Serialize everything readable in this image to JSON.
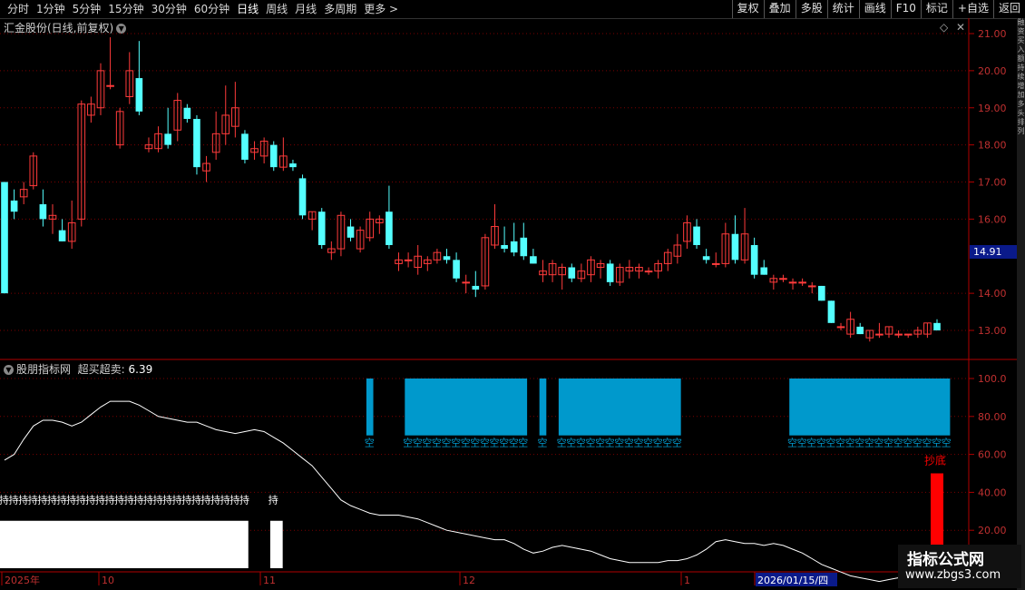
{
  "toolbar": {
    "periods": [
      "分时",
      "1分钟",
      "5分钟",
      "15分钟",
      "30分钟",
      "60分钟",
      "日线",
      "周线",
      "月线",
      "多周期",
      "更多 >"
    ],
    "active_period": "日线",
    "actions": [
      "复权",
      "叠加",
      "多股",
      "统计",
      "画线",
      "F10",
      "标记",
      "+自选",
      "返回"
    ]
  },
  "chart": {
    "title": "汇金股份(日线,前复权)",
    "current_price": "14.91",
    "y_ticks": [
      "21.00",
      "20.00",
      "19.00",
      "18.00",
      "17.00",
      "16.00",
      "14.00",
      "13.00"
    ],
    "candles": [
      {
        "o": 17.0,
        "h": 17.0,
        "l": 14.0,
        "c": 14.0
      },
      {
        "o": 16.5,
        "h": 16.8,
        "l": 16.0,
        "c": 16.2
      },
      {
        "o": 16.6,
        "h": 17.0,
        "l": 16.4,
        "c": 16.8
      },
      {
        "o": 16.9,
        "h": 17.8,
        "l": 16.8,
        "c": 17.7
      },
      {
        "o": 16.4,
        "h": 16.8,
        "l": 15.8,
        "c": 16.0
      },
      {
        "o": 16.0,
        "h": 16.4,
        "l": 15.6,
        "c": 16.1
      },
      {
        "o": 15.7,
        "h": 16.0,
        "l": 15.4,
        "c": 15.4
      },
      {
        "o": 15.4,
        "h": 16.5,
        "l": 15.2,
        "c": 15.9
      },
      {
        "o": 16.0,
        "h": 19.2,
        "l": 15.8,
        "c": 19.1
      },
      {
        "o": 18.8,
        "h": 19.3,
        "l": 18.6,
        "c": 19.1
      },
      {
        "o": 19.0,
        "h": 20.2,
        "l": 18.8,
        "c": 20.0
      },
      {
        "o": 19.6,
        "h": 20.9,
        "l": 19.5,
        "c": 19.6
      },
      {
        "o": 18.0,
        "h": 19.0,
        "l": 17.9,
        "c": 18.9
      },
      {
        "o": 19.3,
        "h": 20.5,
        "l": 19.1,
        "c": 20.0
      },
      {
        "o": 19.8,
        "h": 20.8,
        "l": 18.8,
        "c": 18.9
      },
      {
        "o": 17.9,
        "h": 18.2,
        "l": 17.8,
        "c": 18.0
      },
      {
        "o": 17.9,
        "h": 18.5,
        "l": 17.8,
        "c": 18.3
      },
      {
        "o": 18.3,
        "h": 19.0,
        "l": 17.9,
        "c": 18.0
      },
      {
        "o": 18.4,
        "h": 19.4,
        "l": 18.1,
        "c": 19.2
      },
      {
        "o": 19.0,
        "h": 19.1,
        "l": 18.6,
        "c": 18.7
      },
      {
        "o": 18.7,
        "h": 18.8,
        "l": 17.2,
        "c": 17.4
      },
      {
        "o": 17.3,
        "h": 17.7,
        "l": 17.0,
        "c": 17.5
      },
      {
        "o": 17.8,
        "h": 18.9,
        "l": 17.6,
        "c": 18.3
      },
      {
        "o": 18.3,
        "h": 19.6,
        "l": 18.0,
        "c": 18.8
      },
      {
        "o": 18.5,
        "h": 19.7,
        "l": 18.2,
        "c": 19.0
      },
      {
        "o": 18.3,
        "h": 18.4,
        "l": 17.5,
        "c": 17.6
      },
      {
        "o": 17.8,
        "h": 18.1,
        "l": 17.6,
        "c": 17.9
      },
      {
        "o": 17.7,
        "h": 18.2,
        "l": 17.5,
        "c": 18.1
      },
      {
        "o": 18.0,
        "h": 18.1,
        "l": 17.3,
        "c": 17.4
      },
      {
        "o": 17.4,
        "h": 18.2,
        "l": 17.3,
        "c": 17.7
      },
      {
        "o": 17.5,
        "h": 17.6,
        "l": 17.3,
        "c": 17.4
      },
      {
        "o": 17.1,
        "h": 17.2,
        "l": 16.0,
        "c": 16.1
      },
      {
        "o": 16.0,
        "h": 16.2,
        "l": 15.7,
        "c": 16.2
      },
      {
        "o": 16.2,
        "h": 16.3,
        "l": 15.2,
        "c": 15.3
      },
      {
        "o": 15.1,
        "h": 15.4,
        "l": 14.9,
        "c": 15.2
      },
      {
        "o": 15.2,
        "h": 16.2,
        "l": 15.0,
        "c": 16.1
      },
      {
        "o": 15.8,
        "h": 16.0,
        "l": 15.4,
        "c": 15.5
      },
      {
        "o": 15.2,
        "h": 15.8,
        "l": 15.1,
        "c": 15.7
      },
      {
        "o": 15.5,
        "h": 16.2,
        "l": 15.4,
        "c": 16.0
      },
      {
        "o": 15.9,
        "h": 16.1,
        "l": 15.6,
        "c": 16.0
      },
      {
        "o": 16.2,
        "h": 16.9,
        "l": 15.2,
        "c": 15.3
      },
      {
        "o": 14.8,
        "h": 15.1,
        "l": 14.6,
        "c": 14.9
      },
      {
        "o": 14.9,
        "h": 15.1,
        "l": 14.7,
        "c": 14.9
      },
      {
        "o": 14.7,
        "h": 15.3,
        "l": 14.5,
        "c": 15.0
      },
      {
        "o": 14.8,
        "h": 15.0,
        "l": 14.6,
        "c": 14.9
      },
      {
        "o": 14.9,
        "h": 15.2,
        "l": 14.8,
        "c": 15.1
      },
      {
        "o": 15.0,
        "h": 15.2,
        "l": 14.8,
        "c": 14.9
      },
      {
        "o": 14.9,
        "h": 15.1,
        "l": 14.3,
        "c": 14.4
      },
      {
        "o": 14.3,
        "h": 14.5,
        "l": 14.0,
        "c": 14.3
      },
      {
        "o": 14.2,
        "h": 14.6,
        "l": 13.9,
        "c": 14.1
      },
      {
        "o": 14.2,
        "h": 15.6,
        "l": 14.1,
        "c": 15.5
      },
      {
        "o": 15.3,
        "h": 16.4,
        "l": 15.2,
        "c": 15.8
      },
      {
        "o": 15.3,
        "h": 15.8,
        "l": 15.1,
        "c": 15.2
      },
      {
        "o": 15.4,
        "h": 15.9,
        "l": 15.0,
        "c": 15.1
      },
      {
        "o": 15.5,
        "h": 15.9,
        "l": 14.9,
        "c": 15.0
      },
      {
        "o": 15.0,
        "h": 15.2,
        "l": 14.8,
        "c": 14.8
      },
      {
        "o": 14.5,
        "h": 14.9,
        "l": 14.3,
        "c": 14.6
      },
      {
        "o": 14.5,
        "h": 14.9,
        "l": 14.3,
        "c": 14.8
      },
      {
        "o": 14.5,
        "h": 14.8,
        "l": 14.1,
        "c": 14.7
      },
      {
        "o": 14.7,
        "h": 14.8,
        "l": 14.3,
        "c": 14.4
      },
      {
        "o": 14.4,
        "h": 14.8,
        "l": 14.3,
        "c": 14.6
      },
      {
        "o": 14.5,
        "h": 15.0,
        "l": 14.3,
        "c": 14.9
      },
      {
        "o": 14.7,
        "h": 14.9,
        "l": 14.4,
        "c": 14.8
      },
      {
        "o": 14.8,
        "h": 14.9,
        "l": 14.2,
        "c": 14.3
      },
      {
        "o": 14.3,
        "h": 14.8,
        "l": 14.2,
        "c": 14.7
      },
      {
        "o": 14.6,
        "h": 14.9,
        "l": 14.4,
        "c": 14.7
      },
      {
        "o": 14.6,
        "h": 14.8,
        "l": 14.4,
        "c": 14.7
      },
      {
        "o": 14.6,
        "h": 14.7,
        "l": 14.5,
        "c": 14.6
      },
      {
        "o": 14.6,
        "h": 14.9,
        "l": 14.4,
        "c": 14.8
      },
      {
        "o": 14.8,
        "h": 15.2,
        "l": 14.6,
        "c": 15.1
      },
      {
        "o": 15.0,
        "h": 15.6,
        "l": 14.8,
        "c": 15.3
      },
      {
        "o": 15.4,
        "h": 16.1,
        "l": 15.2,
        "c": 15.9
      },
      {
        "o": 15.8,
        "h": 16.0,
        "l": 15.2,
        "c": 15.3
      },
      {
        "o": 15.0,
        "h": 15.2,
        "l": 14.8,
        "c": 14.9
      },
      {
        "o": 14.8,
        "h": 15.1,
        "l": 14.7,
        "c": 14.8
      },
      {
        "o": 14.8,
        "h": 15.9,
        "l": 14.7,
        "c": 15.6
      },
      {
        "o": 15.6,
        "h": 16.1,
        "l": 14.8,
        "c": 14.9
      },
      {
        "o": 14.9,
        "h": 16.3,
        "l": 14.8,
        "c": 15.6
      },
      {
        "o": 15.3,
        "h": 15.5,
        "l": 14.4,
        "c": 14.5
      },
      {
        "o": 14.7,
        "h": 14.9,
        "l": 14.5,
        "c": 14.5
      },
      {
        "o": 14.3,
        "h": 14.5,
        "l": 14.1,
        "c": 14.4
      },
      {
        "o": 14.4,
        "h": 14.5,
        "l": 14.3,
        "c": 14.4
      },
      {
        "o": 14.3,
        "h": 14.4,
        "l": 14.1,
        "c": 14.3
      },
      {
        "o": 14.3,
        "h": 14.4,
        "l": 14.2,
        "c": 14.3
      },
      {
        "o": 14.2,
        "h": 14.3,
        "l": 14.0,
        "c": 14.2
      },
      {
        "o": 14.2,
        "h": 14.2,
        "l": 13.8,
        "c": 13.8
      },
      {
        "o": 13.8,
        "h": 13.8,
        "l": 13.2,
        "c": 13.2
      },
      {
        "o": 13.1,
        "h": 13.2,
        "l": 13.0,
        "c": 13.1
      },
      {
        "o": 12.9,
        "h": 13.5,
        "l": 12.8,
        "c": 13.3
      },
      {
        "o": 13.1,
        "h": 13.2,
        "l": 12.9,
        "c": 12.9
      },
      {
        "o": 12.8,
        "h": 13.0,
        "l": 12.7,
        "c": 13.0
      },
      {
        "o": 12.9,
        "h": 13.2,
        "l": 12.8,
        "c": 12.9
      },
      {
        "o": 12.9,
        "h": 13.1,
        "l": 12.8,
        "c": 13.1
      },
      {
        "o": 12.9,
        "h": 13.0,
        "l": 12.8,
        "c": 12.9
      },
      {
        "o": 12.9,
        "h": 12.9,
        "l": 12.8,
        "c": 12.9
      },
      {
        "o": 12.9,
        "h": 13.1,
        "l": 12.8,
        "c": 13.0
      },
      {
        "o": 12.9,
        "h": 13.2,
        "l": 12.8,
        "c": 13.2
      },
      {
        "o": 13.2,
        "h": 13.3,
        "l": 13.0,
        "c": 13.0
      }
    ],
    "up_color": "#ff3b3b",
    "down_color": "#54ffff"
  },
  "indicator": {
    "title": "股朋指标网",
    "name": "超买超卖:",
    "value": "6.39",
    "y_ticks": [
      "100.0",
      "80.00",
      "60.00",
      "40.00",
      "20.00"
    ],
    "line": [
      57,
      60,
      68,
      75,
      78,
      78,
      77,
      75,
      77,
      81,
      85,
      88,
      88,
      88,
      86,
      83,
      80,
      79,
      78,
      77,
      77,
      75,
      73,
      72,
      71,
      72,
      73,
      72,
      69,
      66,
      62,
      58,
      54,
      48,
      42,
      36,
      33,
      31,
      29,
      28,
      28,
      28,
      27,
      26,
      24,
      22,
      20,
      19,
      18,
      17,
      16,
      15,
      15,
      13,
      10,
      8,
      9,
      11,
      12,
      11,
      10,
      9,
      7,
      5,
      4,
      3,
      3,
      3,
      3,
      4,
      4,
      5,
      7,
      10,
      14,
      15,
      14,
      13,
      13,
      12,
      13,
      12,
      10,
      8,
      5,
      2,
      0,
      -2,
      -4,
      -5,
      -6,
      -7,
      -6,
      -5,
      -5,
      -5,
      -5,
      -5,
      -5
    ],
    "overbought_label": "空",
    "bottom_label": "抄底",
    "hold_label": "持",
    "overbought_color": "#0099cc",
    "bottom_color": "#ff0000"
  },
  "x_axis": {
    "labels": [
      "2025年",
      "10",
      "11",
      "12",
      "1",
      "2026/01/15/四"
    ]
  },
  "watermark": {
    "line1": "指标公式网",
    "line2": "www.zbgs3.com"
  }
}
